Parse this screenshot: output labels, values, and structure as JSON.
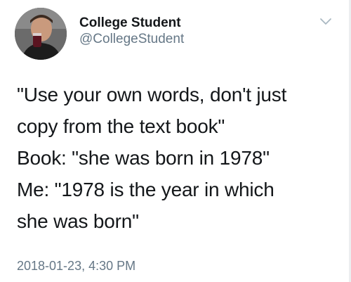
{
  "author": {
    "display_name": "College Student",
    "handle": "@CollegeStudent",
    "avatar_icon": "profile-photo"
  },
  "menu": {
    "icon": "chevron-down-icon"
  },
  "tweet": {
    "lines": [
      "\"Use your own words, don't just",
      "copy from the text book\"",
      "Book: \"she was born in 1978\"",
      "Me: \"1978 is the year in which",
      "she was born\""
    ],
    "timestamp": "2018-01-23, 4:30 PM"
  },
  "colors": {
    "text": "#14171a",
    "secondary": "#657786",
    "chevron": "#aab8c2"
  }
}
